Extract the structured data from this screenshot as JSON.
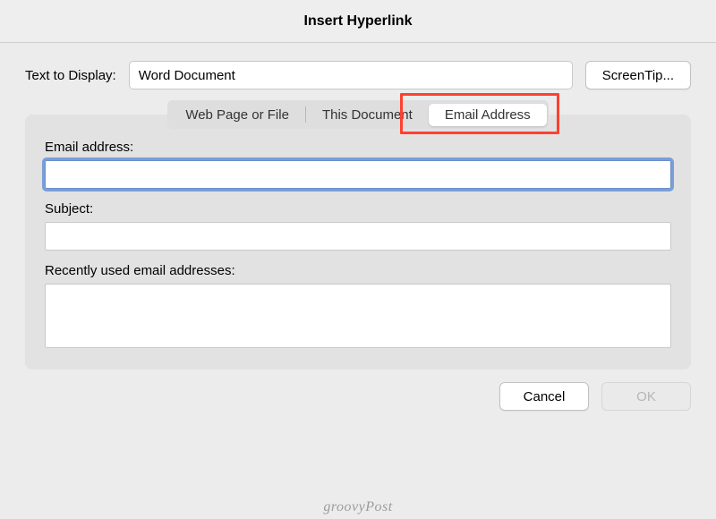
{
  "dialog": {
    "title": "Insert Hyperlink"
  },
  "display": {
    "label": "Text to Display:",
    "value": "Word Document",
    "screentip_label": "ScreenTip..."
  },
  "tabs": {
    "web": "Web Page or File",
    "doc": "This Document",
    "email": "Email Address"
  },
  "fields": {
    "email_label": "Email address:",
    "email_value": "",
    "subject_label": "Subject:",
    "subject_value": "",
    "recent_label": "Recently used email addresses:"
  },
  "buttons": {
    "cancel": "Cancel",
    "ok": "OK"
  },
  "watermark": "groovyPost"
}
